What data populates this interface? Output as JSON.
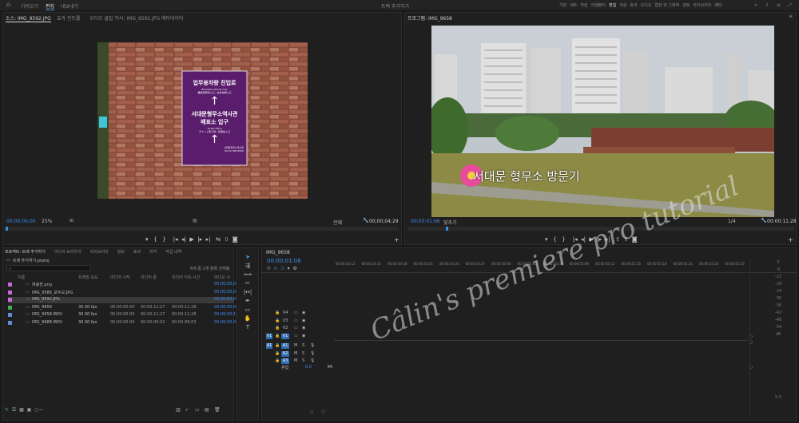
{
  "topbar": {
    "left_tabs": [
      "가져오기",
      "편집",
      "내보내기"
    ],
    "project_title": "트랙 추가하기",
    "workspaces": [
      "기본",
      "세트",
      "학습",
      "어셈블리",
      "편집",
      "색상",
      "효과",
      "오디오",
      "캡션 및 그래픽",
      "검토",
      "라이브러리",
      "메타"
    ],
    "active_workspace": "편집"
  },
  "source_panel": {
    "tabs": [
      "소스: IMG_9592.JPG",
      "효과 컨트롤",
      "오디오 클립 믹서: IMG_9592.JPG",
      "메타데이터"
    ],
    "timecode_in": "00;00;00;00",
    "zoom": "25%",
    "quality": "전체",
    "timecode_out": "00;00;04;29",
    "sign": {
      "line1": "업무용차량 진입로",
      "line1_en": "Business vehicle only",
      "line1_small": "業務用車両入口 / 业务车辆入口",
      "line2a": "서대문형무소역사관",
      "line2b": "매표소 입구",
      "line2_en": "Ticket office",
      "line2_small": "チケット売り場 / 售票处入口",
      "footer": "서대문형무소역사관",
      "footer2": "Tel.02.360.8590"
    }
  },
  "program_panel": {
    "tab": "프로그램: IMG_9658",
    "timecode_in": "00:00:01:06",
    "fit": "맞추기",
    "ratio": "1/4",
    "timecode_out": "00:00:11:28",
    "overlay_text": "서대문 형무소 방문기"
  },
  "project_panel": {
    "tabs": [
      "프로젝트: 트랙 추가하기",
      "미디어 브라우저",
      "라이브러리",
      "정보",
      "효과",
      "마커",
      "작업 내역"
    ],
    "project_file": "트랙 추가하기.prproj",
    "item_count": "6개 중 1개 항목 선택됨",
    "columns": [
      "이름",
      "프레임 속도",
      "미디어 시작",
      "미디어 끝",
      "미디어 지속 시간",
      "비디오 시"
    ],
    "items": [
      {
        "name": "파송한.png",
        "fps": "",
        "start": "",
        "end": "",
        "dur": "",
        "vstart": "00;00;00;00",
        "color": "#c86ad8"
      },
      {
        "name": "IMG_9586_포두모.JPG",
        "fps": "",
        "start": "",
        "end": "",
        "dur": "",
        "vstart": "00;00;00;00",
        "color": "#c86ad8"
      },
      {
        "name": "IMG_9592.JPG",
        "fps": "",
        "start": "",
        "end": "",
        "dur": "",
        "vstart": "00;00;00;00",
        "color": "#c86ad8"
      },
      {
        "name": "IMG_9658",
        "fps": "30.00 fps",
        "start": "00:00:00:00",
        "end": "00:00:11:27",
        "dur": "00:00:11:28",
        "vstart": "00:00:00:00",
        "color": "#3fb04c"
      },
      {
        "name": "IMG_9658.MOV",
        "fps": "30.00 fps",
        "start": "00:00:00:00",
        "end": "00:00:11:27",
        "dur": "00:00:11:28",
        "vstart": "00:00:00:13",
        "color": "#5f8ed8"
      },
      {
        "name": "IMG_9688.MOV",
        "fps": "30.00 fps",
        "start": "00:00:00:00",
        "end": "00:00:09:02",
        "dur": "00:00:09:03",
        "vstart": "00:00:00:00",
        "color": "#5f8ed8"
      }
    ]
  },
  "timeline": {
    "tab": "IMG_9658",
    "timecode": "00:00:01:06",
    "ruler": [
      "00:00:54:12",
      "00:00:54:15",
      "00:00:54:18",
      "00:00:54:21",
      "00:00:54:24",
      "00:00:54:27",
      "00:00:55:00",
      "00:00:55:03",
      "00:00:55:06",
      "00:00:55:09",
      "00:00:55:12",
      "00:00:55:15",
      "00:00:55:18",
      "00:00:55:21",
      "00:00:55:24",
      "00:00:55:27"
    ],
    "video_tracks": [
      "V4",
      "V3",
      "V2",
      "V1"
    ],
    "audio_tracks": [
      "A1",
      "A2",
      "A3"
    ],
    "source_patch_video": "V1",
    "source_patch_audio": "A1",
    "mix_label": "혼합",
    "mix_value": "0.0",
    "track_letters": [
      "M",
      "S"
    ]
  },
  "watermark": "Câlin's premiere pro tutorial"
}
